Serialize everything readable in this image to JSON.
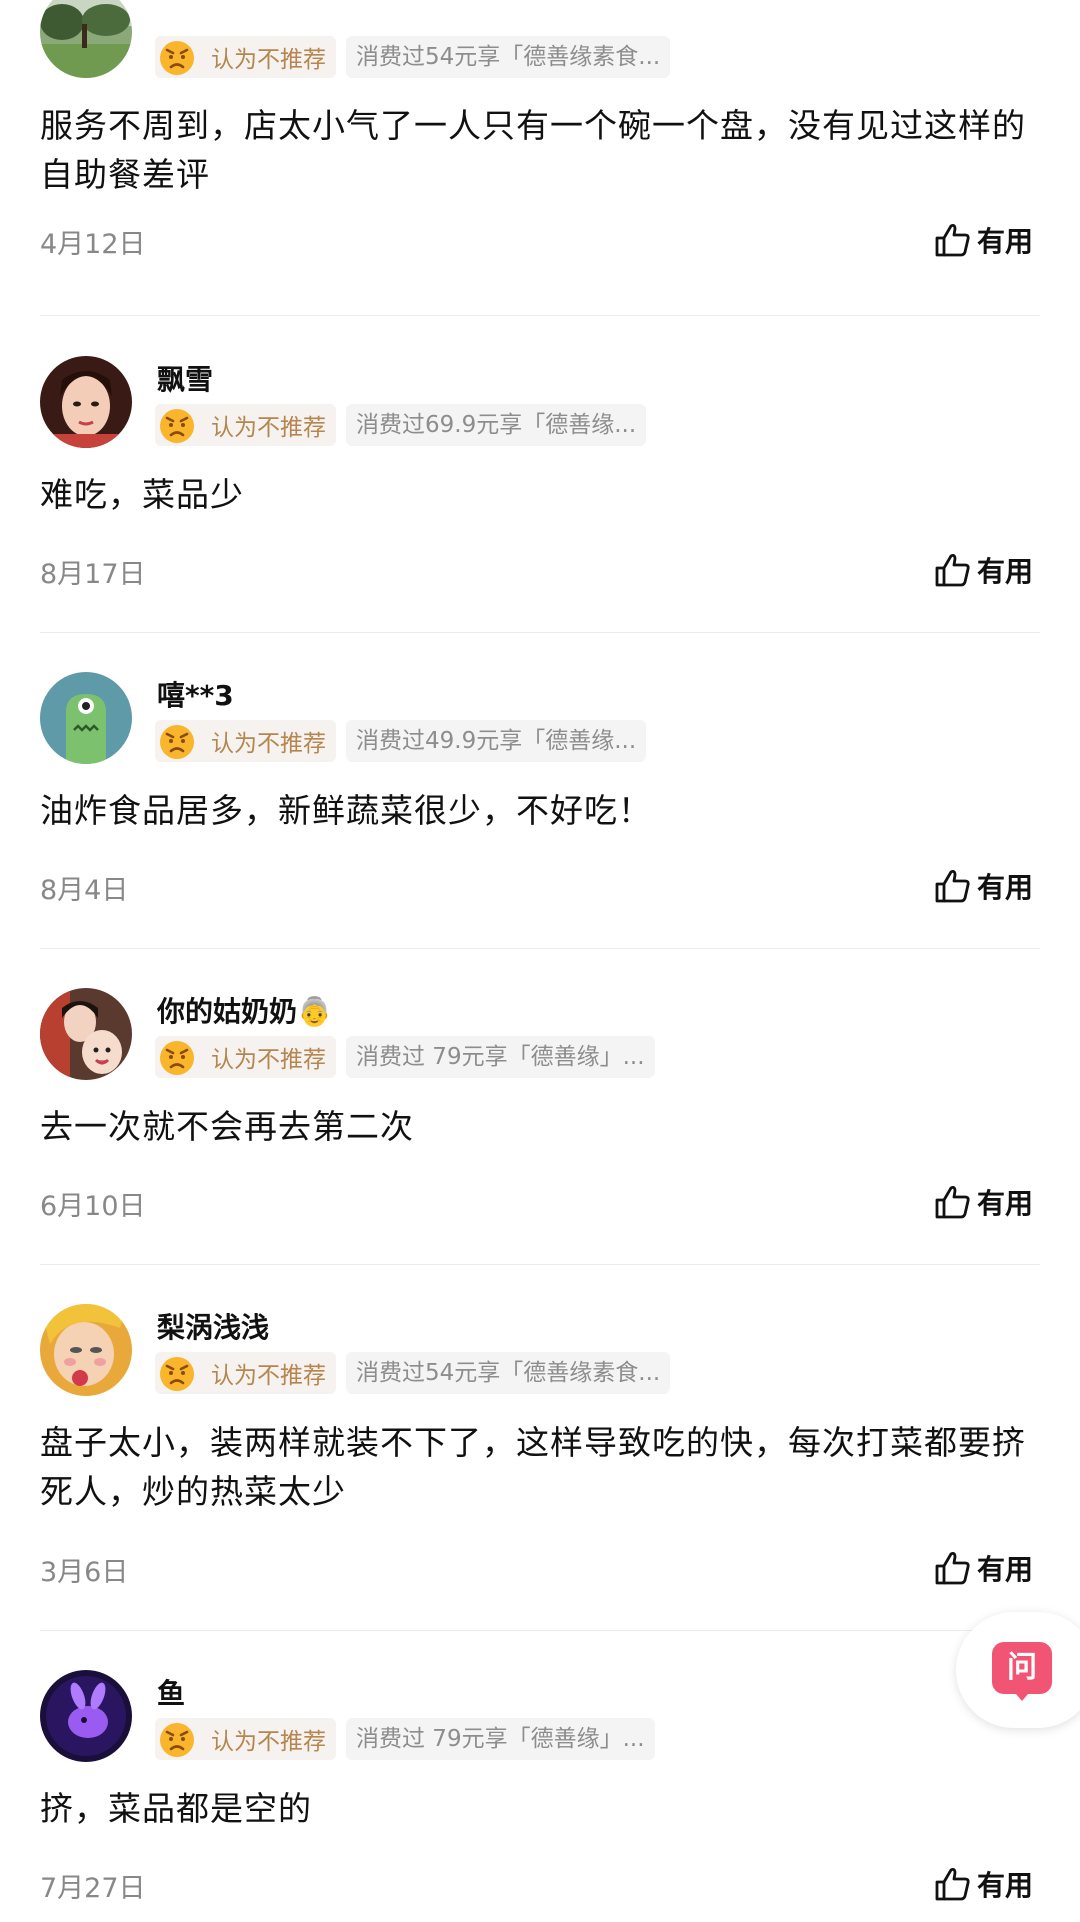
{
  "useful_label": "有用",
  "ask_button_label": "问",
  "colors": {
    "recommend_text": "#b5864f",
    "recommend_bg": "#f5f2ef",
    "spend_text": "#8d8d8d",
    "face_icon": "#f9b52c",
    "ask_icon": "#f25574"
  },
  "reviews": [
    {
      "username": "",
      "avatar_icon": "landscape-avatar-icon",
      "recommend_label": "认为不推荐",
      "spend_label": "消费过54元享「德善缘素食...",
      "text": "服务不周到，店太小气了一人只有一个碗一个盘，没有见过这样的自助餐差评",
      "date": "4月12日"
    },
    {
      "username": "飘雪",
      "avatar_icon": "woman-avatar-icon",
      "recommend_label": "认为不推荐",
      "spend_label": "消费过69.9元享「德善缘...",
      "text": "难吃，菜品少",
      "date": "8月17日"
    },
    {
      "username": "嘻**3",
      "avatar_icon": "green-monster-avatar-icon",
      "recommend_label": "认为不推荐",
      "spend_label": "消费过49.9元享「德善缘...",
      "text": "油炸食品居多，新鲜蔬菜很少，不好吃！",
      "date": "8月4日"
    },
    {
      "username": "你的姑奶奶👵",
      "avatar_icon": "mother-baby-avatar-icon",
      "recommend_label": "认为不推荐",
      "spend_label": "消费过 79元享「德善缘」...",
      "text": "去一次就不会再去第二次",
      "date": "6月10日"
    },
    {
      "username": "梨涡浅浅",
      "avatar_icon": "cartoon-face-avatar-icon",
      "recommend_label": "认为不推荐",
      "spend_label": "消费过54元享「德善缘素食...",
      "text": "盘子太小，装两样就装不下了，这样导致吃的快，每次打菜都要挤死人，炒的热菜太少",
      "date": "3月6日"
    },
    {
      "username": "鱼",
      "avatar_icon": "purple-rabbit-avatar-icon",
      "recommend_label": "认为不推荐",
      "spend_label": "消费过 79元享「德善缘」...",
      "text": "挤，菜品都是空的",
      "date": "7月27日"
    }
  ]
}
